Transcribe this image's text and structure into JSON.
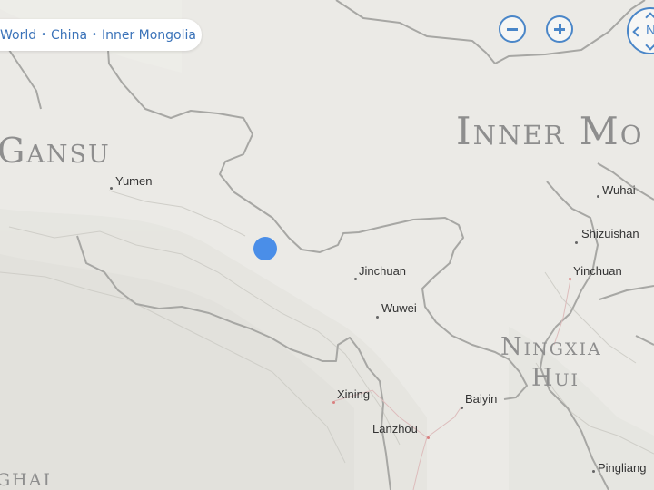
{
  "breadcrumb": {
    "items": [
      "World",
      "China",
      "Inner Mongolia"
    ],
    "separator": "•"
  },
  "controls": {
    "zoom_out": "zoom-out",
    "zoom_in": "zoom-in",
    "compass_label": "N"
  },
  "regions": {
    "gansu": "Gansu",
    "inner_mongolia": "Inner Mo",
    "ningxia_1": "Ningxia",
    "ningxia_2": "Hui",
    "qinghai": "ghai"
  },
  "cities": {
    "yumen": "Yumen",
    "wuhai": "Wuhai",
    "shizuishan": "Shizuishan",
    "yinchuan": "Yinchuan",
    "jinchuan": "Jinchuan",
    "wuwei": "Wuwei",
    "xining": "Xining",
    "baiyin": "Baiyin",
    "lanzhou": "Lanzhou",
    "pingliang": "Pingliang"
  },
  "colors": {
    "accent": "#4a86c8",
    "location": "#4a8ee8",
    "land": "#ebeae6",
    "border": "#a7a7a4",
    "city_marker_red": "#d98080"
  }
}
